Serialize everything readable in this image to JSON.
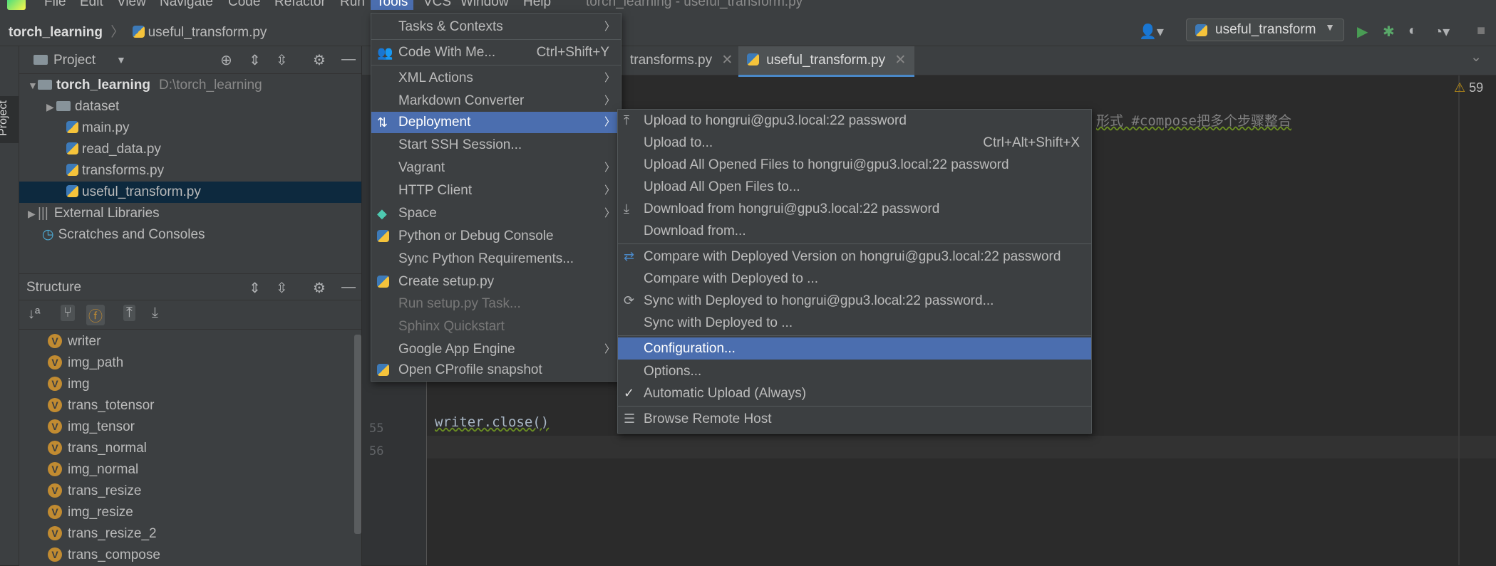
{
  "menubar": {
    "items": [
      "File",
      "Edit",
      "View",
      "Navigate",
      "Code",
      "Refactor",
      "Run",
      "Tools",
      "VCS",
      "Window",
      "Help"
    ],
    "window_title": "torch_learning - useful_transform.py"
  },
  "navbar": {
    "project": "torch_learning",
    "file": "useful_transform.py",
    "run_config": "useful_transform"
  },
  "left_stripe": {
    "project_tab": "Project"
  },
  "project_panel": {
    "title": "Project",
    "tree": [
      {
        "label": "torch_learning",
        "path": "D:\\torch_learning"
      },
      {
        "label": "dataset"
      },
      {
        "label": "main.py"
      },
      {
        "label": "read_data.py"
      },
      {
        "label": "transforms.py"
      },
      {
        "label": "useful_transform.py"
      },
      {
        "label": "External Libraries"
      },
      {
        "label": "Scratches and Consoles"
      }
    ]
  },
  "structure_panel": {
    "title": "Structure",
    "items": [
      "writer",
      "img_path",
      "img",
      "trans_totensor",
      "img_tensor",
      "trans_normal",
      "img_normal",
      "trans_resize",
      "img_resize",
      "trans_resize_2",
      "trans_compose"
    ]
  },
  "editor": {
    "tabs": [
      "transforms.py",
      "useful_transform.py"
    ],
    "warning_count": "59",
    "comment_fragment": "形式 #compose把多个步骤整合",
    "lines": [
      {
        "no": "55",
        "code": ""
      },
      {
        "no": "56",
        "code": "writer.close()"
      }
    ]
  },
  "tools_menu": {
    "items": [
      {
        "label": "Tasks & Contexts",
        "sub": true
      },
      {
        "label": "Code With Me...",
        "shortcut": "Ctrl+Shift+Y"
      },
      {
        "label": "XML Actions",
        "sub": true
      },
      {
        "label": "Markdown Converter",
        "sub": true
      },
      {
        "label": "Deployment",
        "sub": true
      },
      {
        "label": "Start SSH Session..."
      },
      {
        "label": "Vagrant",
        "sub": true
      },
      {
        "label": "HTTP Client",
        "sub": true
      },
      {
        "label": "Space",
        "sub": true
      },
      {
        "label": "Python or Debug Console"
      },
      {
        "label": "Sync Python Requirements..."
      },
      {
        "label": "Create setup.py"
      },
      {
        "label": "Run setup.py Task..."
      },
      {
        "label": "Sphinx Quickstart"
      },
      {
        "label": "Google App Engine",
        "sub": true
      },
      {
        "label": "Open CProfile snapshot"
      }
    ]
  },
  "deployment_menu": {
    "items": [
      {
        "label": "Upload to hongrui@gpu3.local:22 password"
      },
      {
        "label": "Upload to...",
        "shortcut": "Ctrl+Alt+Shift+X"
      },
      {
        "label": "Upload All Opened Files to hongrui@gpu3.local:22 password"
      },
      {
        "label": "Upload All Open Files to..."
      },
      {
        "label": "Download from hongrui@gpu3.local:22 password"
      },
      {
        "label": "Download from..."
      },
      {
        "label": "Compare with Deployed Version on hongrui@gpu3.local:22 password"
      },
      {
        "label": "Compare with Deployed to ..."
      },
      {
        "label": "Sync with Deployed to hongrui@gpu3.local:22 password..."
      },
      {
        "label": "Sync with Deployed to ..."
      },
      {
        "label": "Configuration..."
      },
      {
        "label": "Options..."
      },
      {
        "label": "Automatic Upload (Always)"
      },
      {
        "label": "Browse Remote Host"
      }
    ]
  },
  "colors": {
    "menu_selected": "#4b6eaf",
    "tree_selected": "#0d293e",
    "editor_bg": "#2b2b2b",
    "panel_bg": "#3c3f41",
    "structure_var": "#c18b31"
  }
}
